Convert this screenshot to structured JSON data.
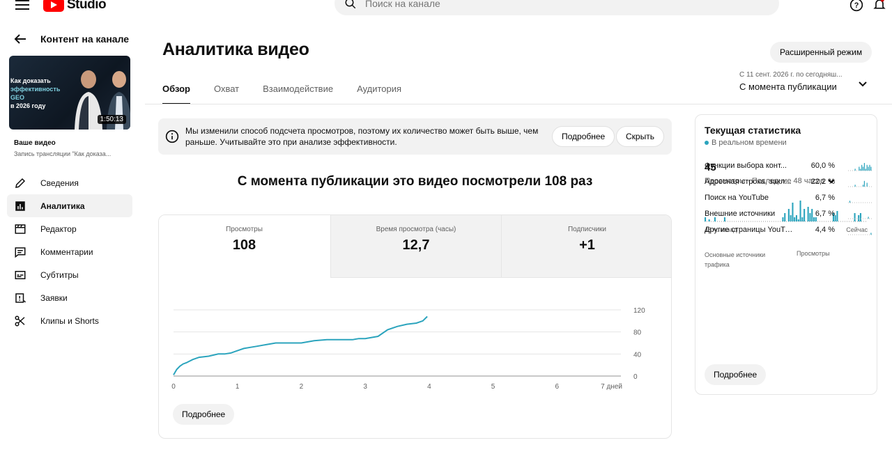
{
  "header": {
    "logo_text": "Studio",
    "search_placeholder": "Поиск на канале"
  },
  "sidebar": {
    "back_label": "Контент на канале",
    "thumbnail": {
      "title_line1": "Как доказать",
      "title_line2": "эффективность GEO",
      "title_line3": "в 2026 году",
      "duration": "1:50:13"
    },
    "your_video_label": "Ваше видео",
    "video_title": "Запись трансляции \"Как доказа...",
    "items": [
      {
        "label": "Сведения",
        "icon": "pencil-icon"
      },
      {
        "label": "Аналитика",
        "icon": "analytics-icon"
      },
      {
        "label": "Редактор",
        "icon": "film-icon"
      },
      {
        "label": "Комментарии",
        "icon": "comment-icon"
      },
      {
        "label": "Субтитры",
        "icon": "subtitles-icon"
      },
      {
        "label": "Заявки",
        "icon": "claims-icon"
      },
      {
        "label": "Клипы и Shorts",
        "icon": "scissors-icon"
      }
    ]
  },
  "main": {
    "title": "Аналитика видео",
    "advanced_mode_label": "Расширенный режим",
    "tabs": [
      {
        "label": "Обзор"
      },
      {
        "label": "Охват"
      },
      {
        "label": "Взаимодействие"
      },
      {
        "label": "Аудитория"
      }
    ],
    "date_range": {
      "subtitle": "С 11 сент. 2026 г. по сегодняш...",
      "label": "С момента публикации"
    },
    "notice": {
      "text": "Мы изменили способ подсчета просмотров, поэтому их количество может быть выше, чем раньше. Учитывайте это при анализе эффективности.",
      "more_label": "Подробнее",
      "hide_label": "Скрыть"
    },
    "headline": "С момента публикации это видео посмотрели 108 раз",
    "metrics": [
      {
        "label": "Просмотры",
        "value": "108"
      },
      {
        "label": "Время просмотра (часы)",
        "value": "12,7"
      },
      {
        "label": "Подписчики",
        "value": "+1"
      }
    ],
    "more_label": "Подробнее"
  },
  "chart_data": {
    "type": "line",
    "x_ticks": [
      "0",
      "1",
      "2",
      "3",
      "4",
      "5",
      "6",
      "7 дней"
    ],
    "y_ticks": [
      "0",
      "40",
      "80",
      "120"
    ],
    "xlim": [
      0,
      7
    ],
    "ylim": [
      0,
      120
    ],
    "color": "#2ba4bd",
    "series": [
      {
        "x": [
          0,
          0.05,
          0.1,
          0.15,
          0.2,
          0.3,
          0.4,
          0.55,
          0.7,
          0.8,
          0.9,
          1.0,
          1.1,
          1.2,
          1.3,
          1.45,
          1.6,
          1.8,
          2.0,
          2.1,
          2.2,
          2.4,
          2.6,
          2.8,
          2.9,
          3.0,
          3.1,
          3.2,
          3.35,
          3.5,
          3.65,
          3.8,
          3.9,
          3.97
        ],
        "y": [
          2,
          12,
          18,
          22,
          24,
          30,
          34,
          36,
          40,
          40,
          42,
          46,
          50,
          52,
          54,
          57,
          60,
          60,
          60,
          62,
          64,
          66,
          66,
          66,
          68,
          68,
          70,
          72,
          84,
          90,
          94,
          96,
          100,
          108
        ]
      }
    ]
  },
  "realtime": {
    "title": "Текущая статистика",
    "subtitle": "В реальном времени",
    "count": "45",
    "views_label": "Просмотры · Последние 48 часов",
    "ago_label": "48 ч. назад",
    "now_label": "Сейчас",
    "bars": [
      2,
      0,
      1,
      0,
      0,
      2,
      0,
      0,
      0,
      0,
      2,
      0,
      0,
      0,
      0,
      0,
      0,
      0,
      0,
      0,
      0,
      0,
      0,
      0,
      0,
      0,
      0,
      0,
      0,
      0,
      0,
      0,
      0,
      0,
      0,
      0,
      0,
      0,
      0,
      0,
      2,
      4,
      0,
      6,
      3,
      9,
      2,
      3,
      1,
      10,
      2,
      6,
      0,
      7,
      4,
      6,
      2,
      2,
      0,
      0,
      0,
      0,
      0,
      0,
      0,
      0,
      4,
      3,
      5,
      0,
      0,
      0,
      0,
      0,
      0,
      0,
      0,
      4,
      0,
      3,
      4,
      0,
      0,
      0
    ],
    "bars_color": "#2ba4bd",
    "sources_header": "Основные источники трафика",
    "views_header": "Просмотры",
    "sources": [
      {
        "name": "Функции выбора конт...",
        "percent": "60,0 %",
        "spark": [
          0,
          0,
          0,
          0,
          0,
          1,
          0,
          0,
          2,
          1,
          3,
          2,
          4,
          1,
          3,
          2,
          3,
          2
        ]
      },
      {
        "name": "Адресная строка, закл...",
        "percent": "22,2 %",
        "spark": [
          0,
          0,
          0,
          0,
          0,
          1,
          0,
          0,
          0,
          0,
          0,
          1,
          3,
          0,
          2,
          0,
          0,
          0
        ]
      },
      {
        "name": "Поиск на YouTube",
        "percent": "6,7 %",
        "spark": [
          0,
          1,
          0,
          0,
          0,
          0,
          0,
          0,
          0,
          0,
          0,
          0,
          0,
          0,
          0,
          0,
          0,
          0
        ]
      },
      {
        "name": "Внешние источники",
        "percent": "6,7 %",
        "spark": [
          0,
          0,
          0,
          0,
          0,
          0,
          0,
          0,
          0,
          0,
          0,
          0,
          0,
          0,
          0,
          1,
          0,
          0
        ]
      },
      {
        "name": "Другие страницы YouTu...",
        "percent": "4,4 %",
        "spark": [
          0,
          0,
          0,
          0,
          0,
          0,
          0,
          0,
          0,
          0,
          0,
          0,
          0,
          0,
          0,
          0,
          0,
          1
        ]
      }
    ],
    "more_label": "Подробнее"
  }
}
